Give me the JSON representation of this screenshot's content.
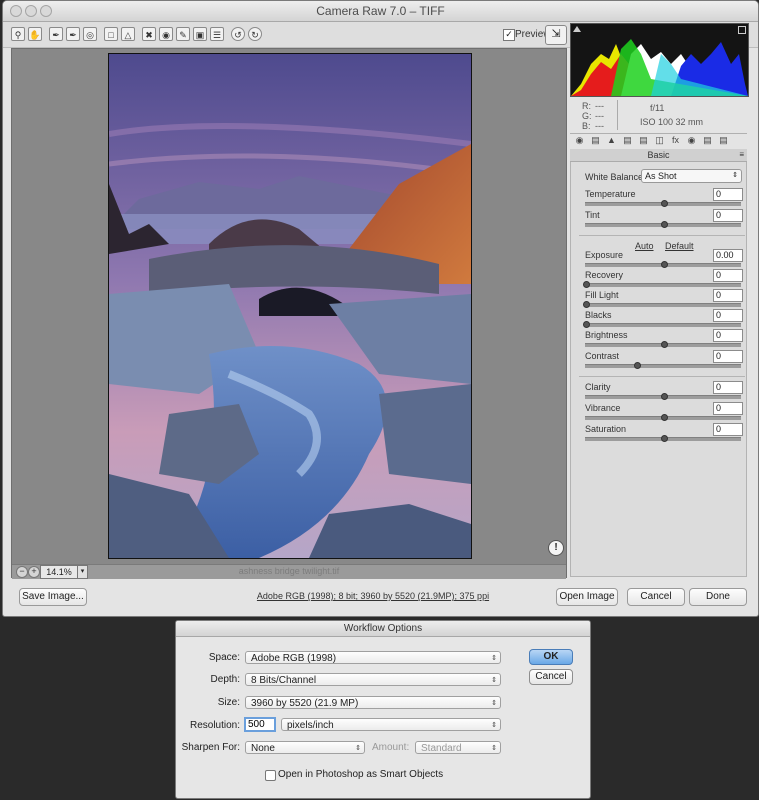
{
  "window": {
    "title": "Camera Raw 7.0  –  TIFF"
  },
  "toolbar": {
    "tools": [
      "zoom-icon",
      "hand-icon",
      "eyedropper-icon",
      "color-sampler-icon",
      "target-adjust-icon",
      "crop-icon",
      "straighten-icon",
      "spot-removal-icon",
      "red-eye-icon",
      "adjustment-brush-icon",
      "graduated-filter-icon",
      "preferences-icon",
      "rotate-ccw-icon",
      "rotate-cw-icon"
    ],
    "preview_label": "Preview",
    "preview_checked": true
  },
  "info": {
    "r_label": "R:",
    "r_value": "---",
    "g_label": "G:",
    "g_value": "---",
    "b_label": "B:",
    "b_value": "---",
    "aperture": "f/11",
    "iso_focal": "ISO 100    32 mm"
  },
  "panel": {
    "title": "Basic",
    "white_balance_label": "White Balance:",
    "white_balance_value": "As Shot",
    "auto_label": "Auto",
    "default_label": "Default",
    "sliders": [
      {
        "label": "Temperature",
        "value": "0",
        "pos": 0.5
      },
      {
        "label": "Tint",
        "value": "0",
        "pos": 0.5
      },
      {
        "label": "Exposure",
        "value": "0.00",
        "pos": 0.5
      },
      {
        "label": "Recovery",
        "value": "0",
        "pos": 0.0
      },
      {
        "label": "Fill Light",
        "value": "0",
        "pos": 0.0
      },
      {
        "label": "Blacks",
        "value": "0",
        "pos": 0.0
      },
      {
        "label": "Brightness",
        "value": "0",
        "pos": 0.5
      },
      {
        "label": "Contrast",
        "value": "0",
        "pos": 0.33
      },
      {
        "label": "Clarity",
        "value": "0",
        "pos": 0.5
      },
      {
        "label": "Vibrance",
        "value": "0",
        "pos": 0.5
      },
      {
        "label": "Saturation",
        "value": "0",
        "pos": 0.5
      }
    ]
  },
  "status": {
    "zoom": "14.1%",
    "filename": "ashness bridge twilight.tif"
  },
  "bottom": {
    "save_label": "Save Image...",
    "workflow_link": "Adobe RGB (1998); 8 bit; 3960 by 5520 (21.9MP); 375 ppi",
    "open_label": "Open Image",
    "cancel_label": "Cancel",
    "done_label": "Done"
  },
  "dialog": {
    "title": "Workflow Options",
    "space_label": "Space:",
    "space_value": "Adobe RGB (1998)",
    "depth_label": "Depth:",
    "depth_value": "8 Bits/Channel",
    "size_label": "Size:",
    "size_value": "3960 by 5520  (21.9 MP)",
    "resolution_label": "Resolution:",
    "resolution_value": "500",
    "resolution_unit": "pixels/inch",
    "sharpen_label": "Sharpen For:",
    "sharpen_value": "None",
    "amount_label": "Amount:",
    "amount_value": "Standard",
    "smart_objects_label": "Open in Photoshop as Smart Objects",
    "ok_label": "OK",
    "cancel_label": "Cancel"
  },
  "colors": {
    "accent": "#6aa8e7",
    "histogram_bg": "#141414"
  }
}
